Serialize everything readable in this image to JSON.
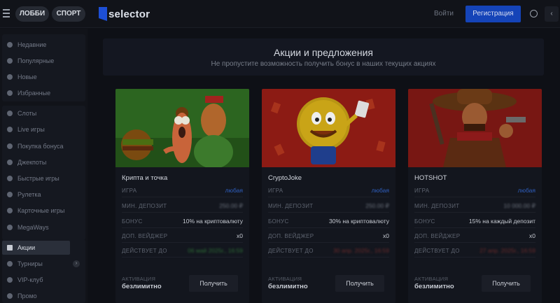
{
  "header": {
    "lobby_label": "ЛОББИ",
    "sport_label": "СПОРТ",
    "logo_text": "selector",
    "login_label": "Войти",
    "register_label": "Регистрация",
    "collapse_glyph": "‹"
  },
  "sidebar": {
    "items": [
      {
        "label": "Недавние",
        "icon": "clock-icon"
      },
      {
        "label": "Популярные",
        "icon": "fire-icon"
      },
      {
        "label": "Новые",
        "icon": "diamond-icon"
      },
      {
        "label": "Избранные",
        "icon": "heart-icon"
      },
      {
        "label": "Слоты",
        "icon": "slots-icon"
      },
      {
        "label": "Live игры",
        "icon": "live-icon"
      },
      {
        "label": "Покупка бонуса",
        "icon": "bonus-icon"
      },
      {
        "label": "Джекпоты",
        "icon": "jackpot-icon"
      },
      {
        "label": "Быстрые игры",
        "icon": "bolt-icon"
      },
      {
        "label": "Рулетка",
        "icon": "roulette-icon"
      },
      {
        "label": "Карточные игры",
        "icon": "cards-icon"
      },
      {
        "label": "MegaWays",
        "icon": "megaways-icon"
      },
      {
        "label": "Акции",
        "icon": "gift-icon",
        "active": true
      },
      {
        "label": "Турниры",
        "icon": "trophy-icon",
        "chevron": "›"
      },
      {
        "label": "VIP-клуб",
        "icon": "star-icon"
      },
      {
        "label": "Промо",
        "icon": "promo-icon"
      }
    ]
  },
  "promo": {
    "title": "Акции и предложения",
    "subtitle": "Не пропустите возможность получить бонус в наших текущих акциях"
  },
  "cards": [
    {
      "title": "Крипта и точка",
      "rows": [
        {
          "key": "ИГРА",
          "value": "любая",
          "style": "blue"
        },
        {
          "key": "МИН. ДЕПОЗИТ",
          "value": "250.00 ₽",
          "style": "blur"
        },
        {
          "key": "БОНУС",
          "value": "10% на криптовалюту",
          "style": ""
        },
        {
          "key": "ДОП. ВЕЙДЖЕР",
          "value": "x0",
          "style": ""
        },
        {
          "key": "ДЕЙСТВУЕТ ДО",
          "value": "06 май 2025г., 16:59",
          "style": "blur green"
        }
      ],
      "activation_label": "АКТИВАЦИЯ",
      "activation_value": "безлимитно",
      "button_label": "Получить"
    },
    {
      "title": "CryptoJoke",
      "rows": [
        {
          "key": "ИГРА",
          "value": "любая",
          "style": "blue"
        },
        {
          "key": "МИН. ДЕПОЗИТ",
          "value": "250.00 ₽",
          "style": "blur"
        },
        {
          "key": "БОНУС",
          "value": "30% на криптовалюту",
          "style": ""
        },
        {
          "key": "ДОП. ВЕЙДЖЕР",
          "value": "x0",
          "style": ""
        },
        {
          "key": "ДЕЙСТВУЕТ ДО",
          "value": "30 апр. 2025г., 16:59",
          "style": "blur red"
        }
      ],
      "activation_label": "АКТИВАЦИЯ",
      "activation_value": "безлимитно",
      "button_label": "Получить"
    },
    {
      "title": "HOTSHOT",
      "rows": [
        {
          "key": "ИГРА",
          "value": "любая",
          "style": "blue"
        },
        {
          "key": "МИН. ДЕПОЗИТ",
          "value": "10 000.00 ₽",
          "style": "blur"
        },
        {
          "key": "БОНУС",
          "value": "15% на каждый депозит",
          "style": ""
        },
        {
          "key": "ДОП. ВЕЙДЖЕР",
          "value": "x0",
          "style": ""
        },
        {
          "key": "ДЕЙСТВУЕТ ДО",
          "value": "27 апр. 2025г., 16:59",
          "style": "blur red"
        }
      ],
      "activation_label": "АКТИВАЦИЯ",
      "activation_value": "безлимитно",
      "button_label": "Получить"
    }
  ],
  "colors": {
    "accent": "#1544b8",
    "background": "#0e1016",
    "panel": "#13161e"
  }
}
